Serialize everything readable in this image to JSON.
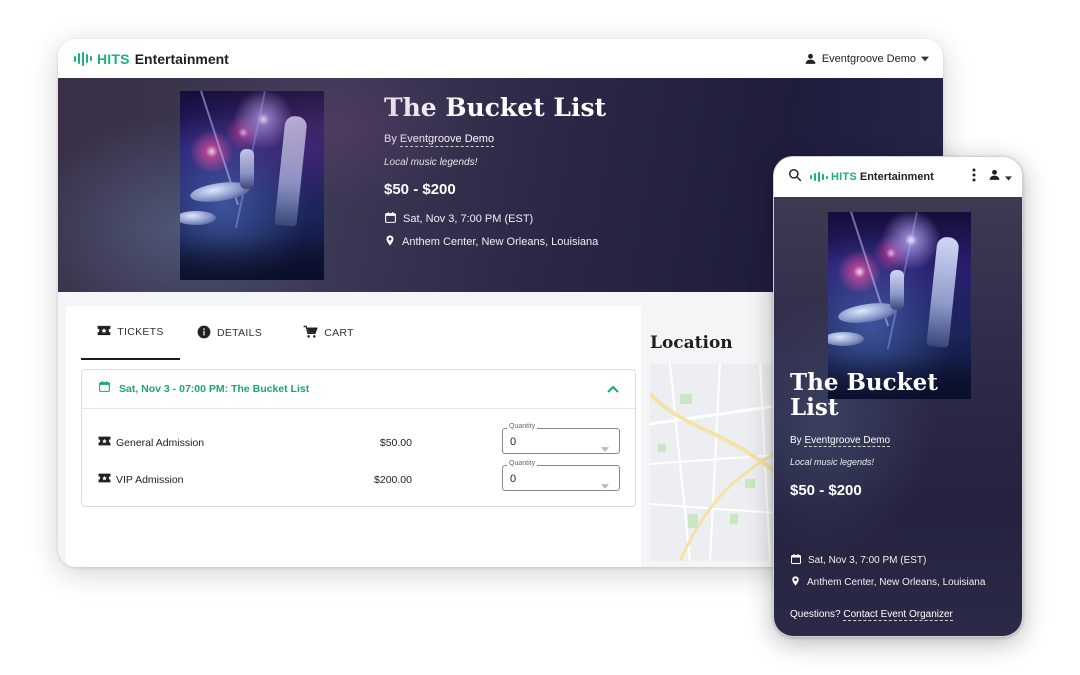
{
  "brand": {
    "hits": "HITS",
    "name": "Entertainment",
    "accent": "#17b27d"
  },
  "header": {
    "user": "Eventgroove Demo",
    "user_icon": "person-icon",
    "caret_icon": "caret-down-icon"
  },
  "event": {
    "title": "The Bucket List",
    "by_prefix": "By",
    "organizer": "Eventgroove Demo",
    "tagline": "Local music legends!",
    "price_range": "$50 - $200",
    "date": "Sat, Nov 3, 7:00 PM (EST)",
    "venue": "Anthem Center, New Orleans, Louisiana"
  },
  "tabs": [
    {
      "label": "TICKETS",
      "icon": "ticket-icon",
      "active": true
    },
    {
      "label": "DETAILS",
      "icon": "info-icon",
      "active": false
    },
    {
      "label": "CART",
      "icon": "cart-icon",
      "active": false
    }
  ],
  "event_card": {
    "title": "Sat, Nov 3 - 07:00 PM: The Bucket List",
    "tickets": [
      {
        "name": "General Admission",
        "price": "$50.00",
        "quantity_label": "Quantity",
        "quantity": "0"
      },
      {
        "name": "VIP Admission",
        "price": "$200.00",
        "quantity_label": "Quantity",
        "quantity": "0"
      }
    ]
  },
  "location": {
    "title": "Location"
  },
  "mobile": {
    "title": "The Bucket List",
    "questions": "Questions?",
    "contact_link": "Contact Event Organizer"
  }
}
